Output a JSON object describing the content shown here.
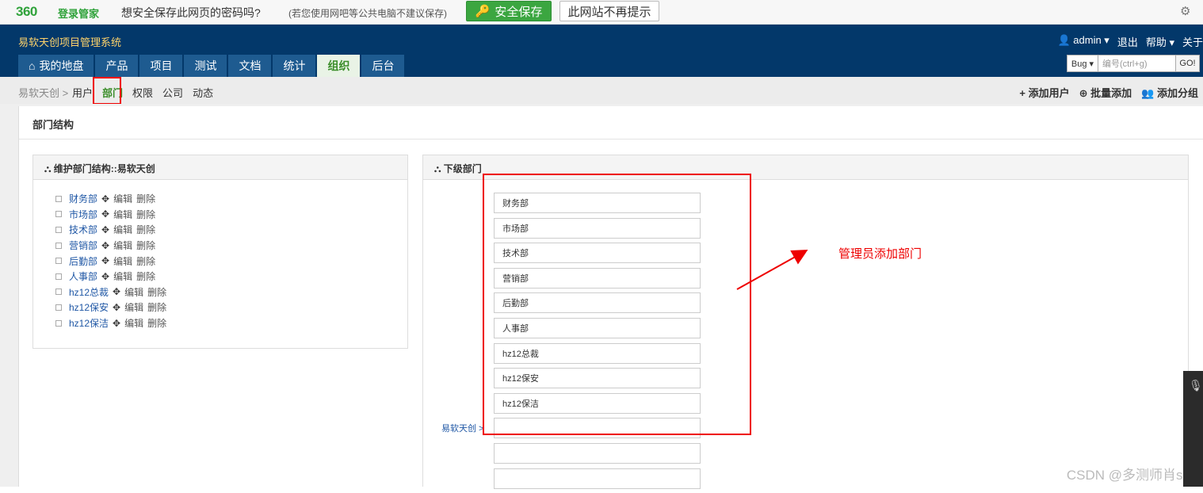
{
  "pwbar": {
    "logo": "360",
    "logo_text": "登录管家",
    "question": "想安全保存此网页的密码吗?",
    "note": "(若您使用网吧等公共电脑不建议保存)",
    "save_label": "安全保存",
    "never_label": "此网站不再提示"
  },
  "header": {
    "app_title": "易软天创项目管理系统",
    "user": "admin ▾",
    "logout": "退出",
    "help": "帮助 ▾",
    "about": "关于",
    "tabs": [
      "我的地盘",
      "产品",
      "项目",
      "测试",
      "文档",
      "统计",
      "组织",
      "后台"
    ],
    "search_type": "Bug ▾",
    "search_placeholder": "编号(ctrl+g)",
    "search_go": "GO!"
  },
  "subnav": {
    "crumb": "易软天创 >",
    "items": [
      "用户",
      "部门",
      "权限",
      "公司",
      "动态"
    ],
    "add_user": "添加用户",
    "batch_add": "批量添加",
    "add_group": "添加分组"
  },
  "panel": {
    "title": "部门结构",
    "left_title": "维护部门结构::易软天创",
    "right_title": "下级部门",
    "edit": "编辑",
    "delete": "删除",
    "departments": [
      "财务部",
      "市场部",
      "技术部",
      "营销部",
      "后勤部",
      "人事部",
      "hz12总裁",
      "hz12保安",
      "hz12保洁"
    ],
    "child_values": [
      "财务部",
      "市场部",
      "技术部",
      "营销部",
      "后勤部",
      "人事部",
      "hz12总裁",
      "hz12保安",
      "hz12保洁",
      "",
      "",
      ""
    ],
    "parent_link": "易软天创 >"
  },
  "annotation": "管理员添加部门",
  "watermark": "CSDN @多测师肖sir"
}
